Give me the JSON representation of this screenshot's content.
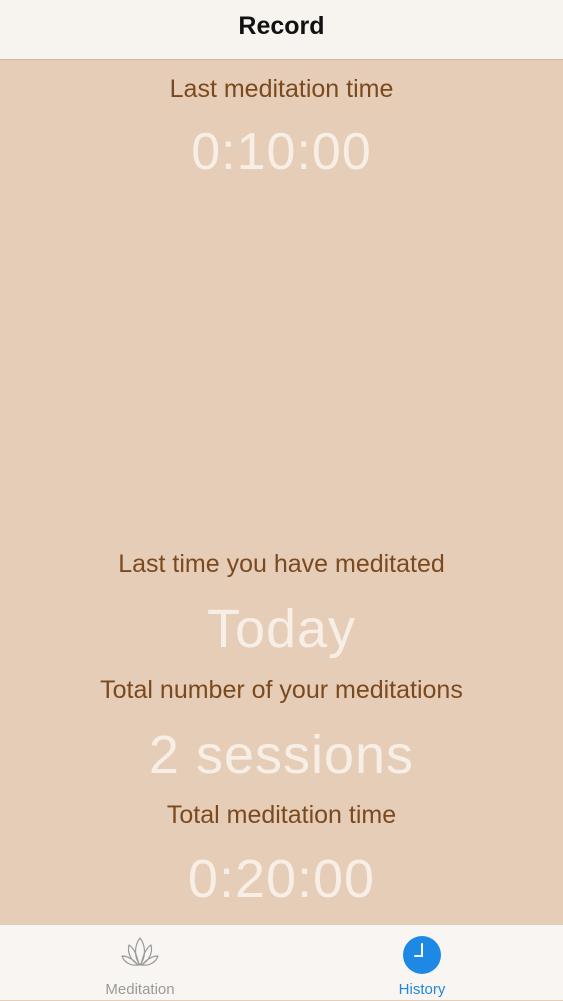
{
  "header": {
    "title": "Record"
  },
  "stats": {
    "last_time_label": "Last meditation time",
    "last_time_value": "0:10:00",
    "last_meditated_label": "Last time you have meditated",
    "last_meditated_value": "Today",
    "total_count_label": "Total number of your meditations",
    "total_count_value": "2 sessions",
    "total_time_label": "Total meditation time",
    "total_time_value": "0:20:00"
  },
  "tabs": [
    {
      "label": "Meditation",
      "icon": "lotus-icon",
      "active": false
    },
    {
      "label": "History",
      "icon": "clock-icon",
      "active": true
    }
  ],
  "colors": {
    "background": "#e6cdb8",
    "label_text": "#7a4a1e",
    "value_text": "#f7eee6",
    "active_tab": "#1e88e5",
    "inactive_tab": "#9a9a9a"
  }
}
